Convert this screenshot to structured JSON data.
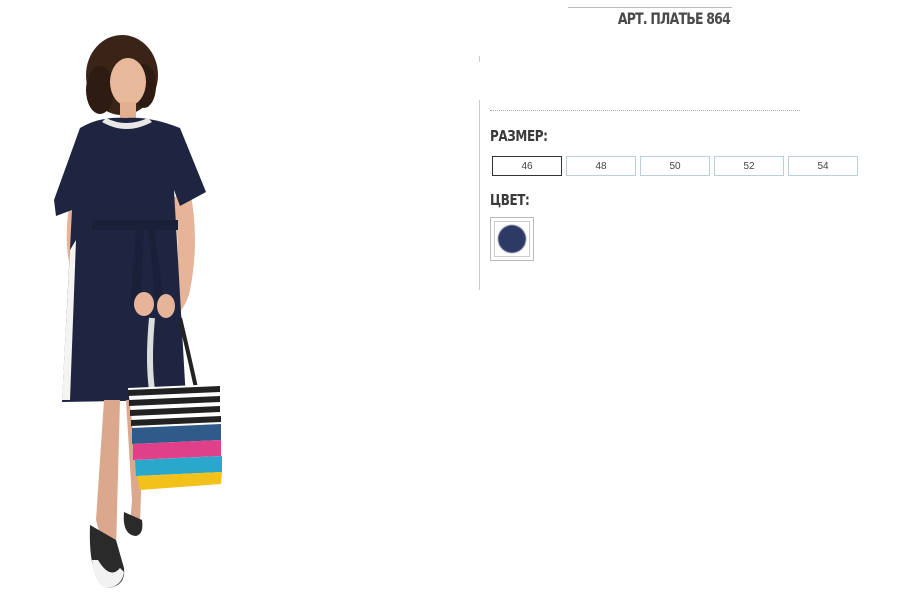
{
  "product": {
    "title": "АРТ. ПЛАТЬЕ 864",
    "photo_alt": ""
  },
  "size": {
    "label": "РАЗМЕР:",
    "options": [
      "46",
      "48",
      "50",
      "52",
      "54"
    ],
    "selected": "46"
  },
  "color": {
    "label": "ЦВЕТ:",
    "swatches": [
      {
        "hex": "#2e3a66"
      }
    ]
  },
  "icons": {
    "swatch": "color-swatch-icon"
  }
}
